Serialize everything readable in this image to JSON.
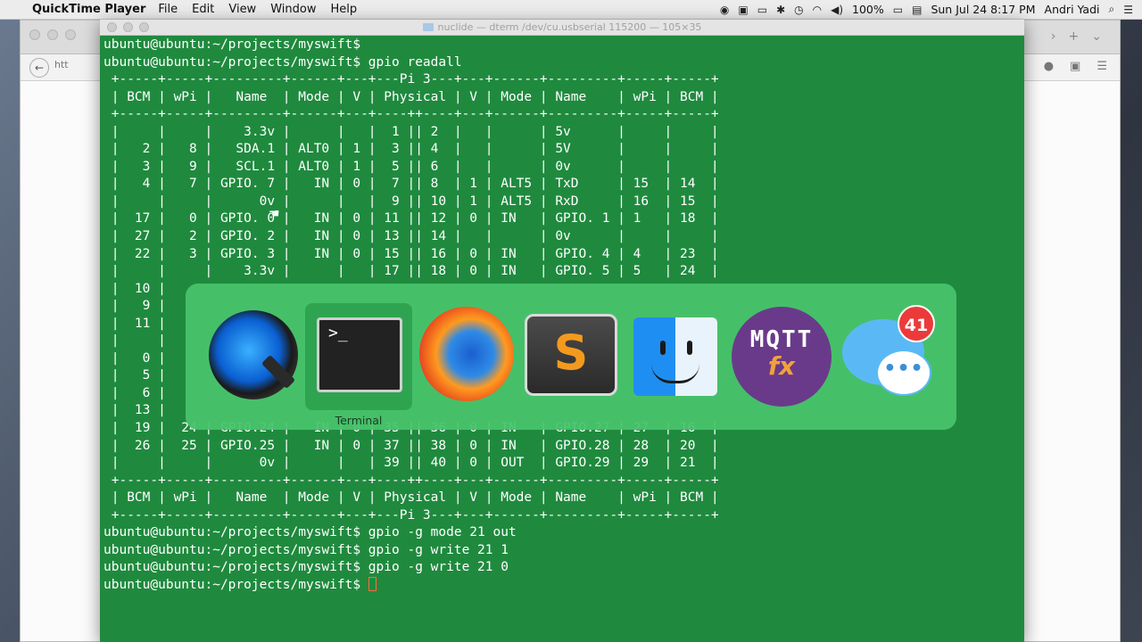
{
  "menubar": {
    "apple_symbol": "",
    "app_name": "QuickTime Player",
    "menus": [
      "File",
      "Edit",
      "View",
      "Window",
      "Help"
    ],
    "battery": "100%",
    "datetime": "Sun Jul 24  8:17 PM",
    "user": "Andri Yadi"
  },
  "browser": {
    "url_stub": "htt"
  },
  "terminal": {
    "title": "nuclide — dterm /dev/cu.usbserial 115200 — 105×35",
    "lines": [
      "ubuntu@ubuntu:~/projects/myswift$",
      "ubuntu@ubuntu:~/projects/myswift$ gpio readall",
      " +-----+-----+---------+------+---+---Pi 3---+---+------+---------+-----+-----+",
      " | BCM | wPi |   Name  | Mode | V | Physical | V | Mode | Name    | wPi | BCM |",
      " +-----+-----+---------+------+---+----++----+---+------+---------+-----+-----+",
      " |     |     |    3.3v |      |   |  1 || 2  |   |      | 5v      |     |     |",
      " |   2 |   8 |   SDA.1 | ALT0 | 1 |  3 || 4  |   |      | 5V      |     |     |",
      " |   3 |   9 |   SCL.1 | ALT0 | 1 |  5 || 6  |   |      | 0v      |     |     |",
      " |   4 |   7 | GPIO. 7 |   IN | 0 |  7 || 8  | 1 | ALT5 | TxD     | 15  | 14  |",
      " |     |     |      0v |      |   |  9 || 10 | 1 | ALT5 | RxD     | 16  | 15  |",
      " |  17 |   0 | GPIO. 0 |   IN | 0 | 11 || 12 | 0 | IN   | GPIO. 1 | 1   | 18  |",
      " |  27 |   2 | GPIO. 2 |   IN | 0 | 13 || 14 |   |      | 0v      |     |     |",
      " |  22 |   3 | GPIO. 3 |   IN | 0 | 15 || 16 | 0 | IN   | GPIO. 4 | 4   | 23  |",
      " |     |     |    3.3v |      |   | 17 || 18 | 0 | IN   | GPIO. 5 | 5   | 24  |",
      " |  10 |",
      " |   9 |",
      " |  11 |",
      " |     |",
      " |   0 |",
      " |   5 |",
      " |   6 |",
      " |  13 |",
      " |  19 |  24 | GPIO.24 |   IN | 0 | 35 || 36 | 0 | IN   | GPIO.27 | 27  | 16  |",
      " |  26 |  25 | GPIO.25 |   IN | 0 | 37 || 38 | 0 | IN   | GPIO.28 | 28  | 20  |",
      " |     |     |      0v |      |   | 39 || 40 | 0 | OUT  | GPIO.29 | 29  | 21  |",
      " +-----+-----+---------+------+---+----++----+---+------+---------+-----+-----+",
      " | BCM | wPi |   Name  | Mode | V | Physical | V | Mode | Name    | wPi | BCM |",
      " +-----+-----+---------+------+---+---Pi 3---+---+------+---------+-----+-----+",
      "ubuntu@ubuntu:~/projects/myswift$ gpio -g mode 21 out",
      "ubuntu@ubuntu:~/projects/myswift$ gpio -g write 21 1",
      "ubuntu@ubuntu:~/projects/myswift$ gpio -g write 21 0",
      "ubuntu@ubuntu:~/projects/myswift$ "
    ]
  },
  "switcher": {
    "selected_label": "Terminal",
    "apps": [
      "QuickTime Player",
      "Terminal",
      "Firefox",
      "Sublime Text",
      "Finder",
      "MQTT.fx",
      "Messages"
    ],
    "terminal_prompt_glyph": ">_",
    "sublime_glyph": "S",
    "mqtt_line1": "MQTT",
    "mqtt_line2": "fx",
    "messages_glyph": "•••",
    "messages_badge": "41"
  },
  "colors": {
    "terminal_bg": "#1f8a3e",
    "switcher_bg": "#48c46c",
    "badge": "#ec3a3a"
  }
}
